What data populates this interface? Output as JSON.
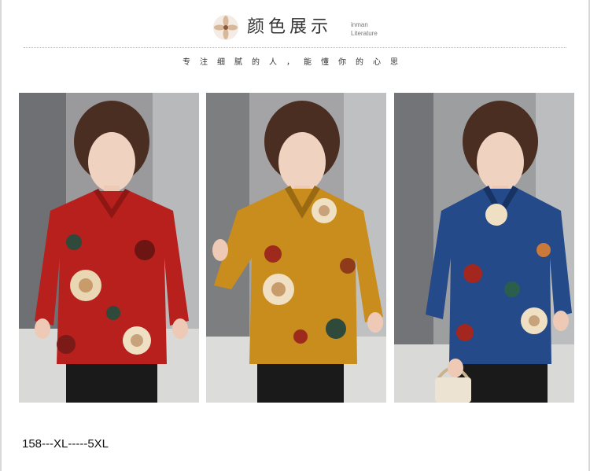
{
  "header": {
    "title": "颜色展示",
    "title_en_line1": "inman",
    "title_en_line2": "Literature",
    "icon": "flower-icon"
  },
  "slogan": "专注细腻的人，能懂你的心思",
  "photos": [
    {
      "shirt_color": "red",
      "accent": "#b8201d",
      "label": ""
    },
    {
      "shirt_color": "mustard",
      "accent": "#c98d1d",
      "label": ""
    },
    {
      "shirt_color": "blue",
      "accent": "#244a8a",
      "label": ""
    }
  ],
  "size_caption": "158---XL-----5XL"
}
